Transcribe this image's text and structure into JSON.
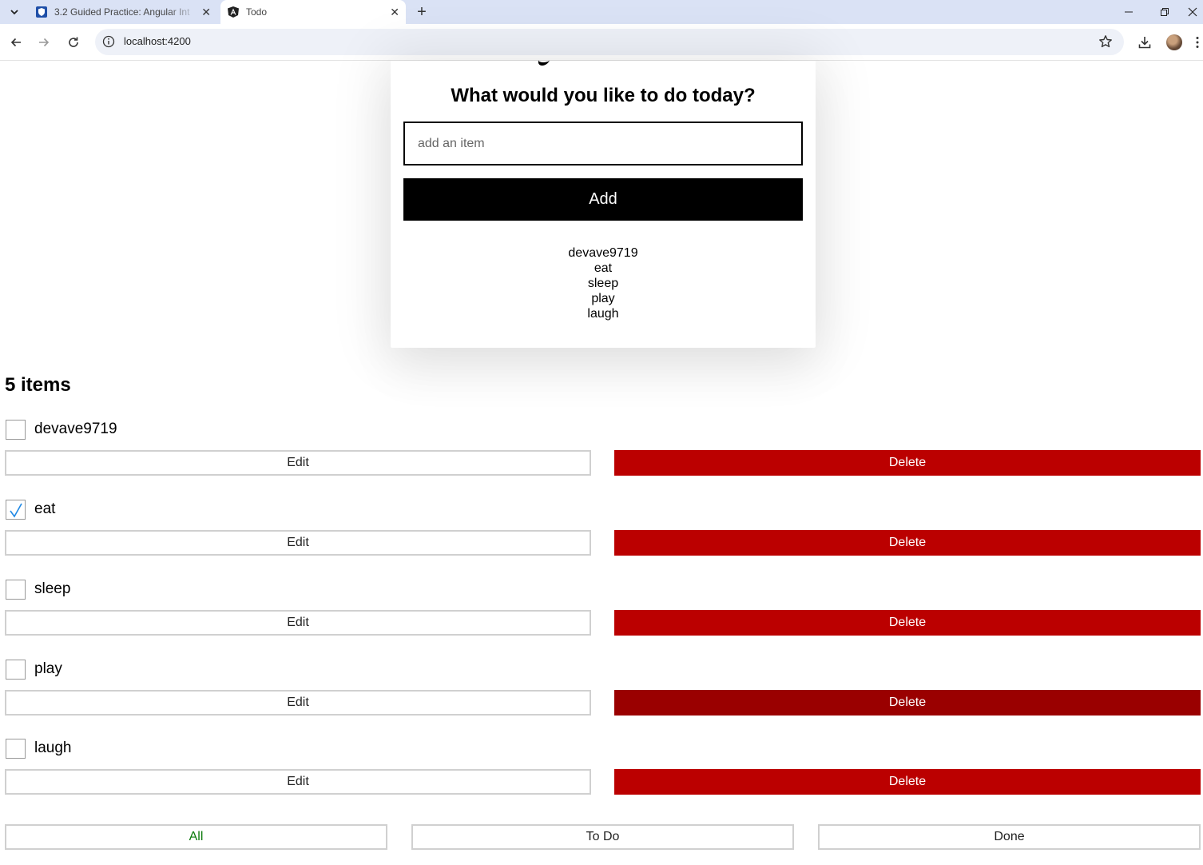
{
  "browser": {
    "tabs": [
      {
        "title": "3.2 Guided Practice: Angular Int",
        "active": false,
        "icon": "shield-favicon"
      },
      {
        "title": "Todo",
        "active": true,
        "icon": "angular-favicon"
      }
    ],
    "url": "localhost:4200"
  },
  "card": {
    "heading": "What would you like to do today?",
    "input_placeholder": "add an item",
    "input_value": "",
    "add_label": "Add",
    "preview_items": [
      "devave9719",
      "eat",
      "sleep",
      "play",
      "laugh"
    ]
  },
  "list": {
    "count_label": "5 items",
    "items": [
      {
        "label": "devave9719",
        "done": false,
        "edit_label": "Edit",
        "delete_label": "Delete"
      },
      {
        "label": "eat",
        "done": true,
        "edit_label": "Edit",
        "delete_label": "Delete"
      },
      {
        "label": "sleep",
        "done": false,
        "edit_label": "Edit",
        "delete_label": "Delete"
      },
      {
        "label": "play",
        "done": false,
        "edit_label": "Edit",
        "delete_label": "Delete"
      },
      {
        "label": "laugh",
        "done": false,
        "edit_label": "Edit",
        "delete_label": "Delete"
      }
    ]
  },
  "filters": {
    "all_label": "All",
    "todo_label": "To Do",
    "done_label": "Done",
    "selected": "All"
  },
  "colors": {
    "delete": "#bb0000",
    "delete_hover": "#9a0000",
    "filter_selected_text": "#0a7a0a",
    "checkmark": "#1e88e5"
  }
}
